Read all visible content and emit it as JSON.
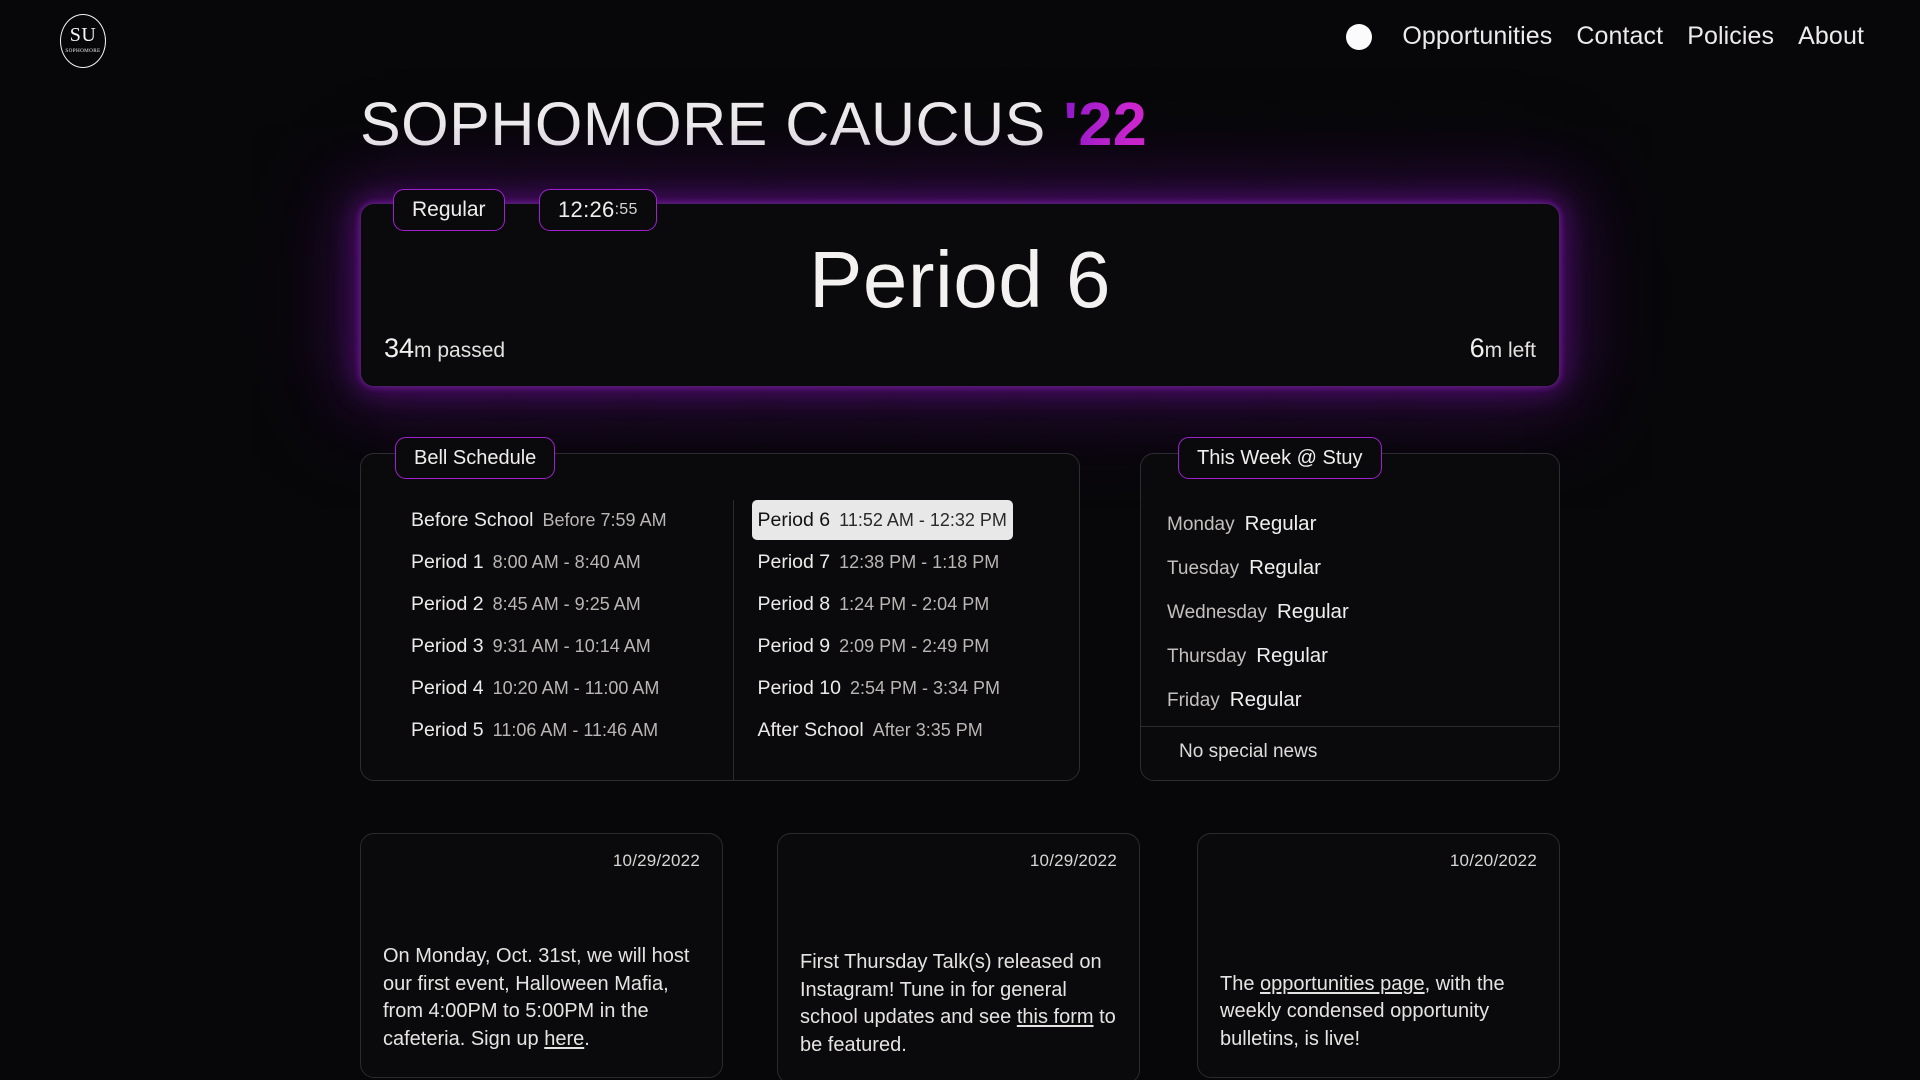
{
  "nav": {
    "logo": {
      "initials": "SU",
      "subtitle": "SOPHOMORE",
      "icon": "su-oval-logo-icon"
    },
    "indicator_icon": "status-dot-icon",
    "links": [
      {
        "label": "Opportunities"
      },
      {
        "label": "Contact"
      },
      {
        "label": "Policies"
      },
      {
        "label": "About"
      }
    ]
  },
  "header": {
    "title_main": "SOPHOMORE CAUCUS ",
    "title_year": "'22"
  },
  "period_card": {
    "schedule_type_pill": "Regular",
    "clock_hm": "12:26",
    "clock_seconds": ":55",
    "period_name": "Period 6",
    "elapsed_value": "34",
    "elapsed_label": "m passed",
    "remaining_value": "6",
    "remaining_label": "m left",
    "glow_color": "#8f1ec4",
    "border_color": "#4a1f68"
  },
  "bell_schedule": {
    "tab_label": "Bell Schedule",
    "left_column": [
      {
        "name": "Before School",
        "time": "Before 7:59 AM",
        "active": false
      },
      {
        "name": "Period 1",
        "time": "8:00 AM - 8:40 AM",
        "active": false
      },
      {
        "name": "Period 2",
        "time": "8:45 AM - 9:25 AM",
        "active": false
      },
      {
        "name": "Period 3",
        "time": "9:31 AM - 10:14 AM",
        "active": false
      },
      {
        "name": "Period 4",
        "time": "10:20 AM - 11:00 AM",
        "active": false
      },
      {
        "name": "Period 5",
        "time": "11:06 AM - 11:46 AM",
        "active": false
      }
    ],
    "right_column": [
      {
        "name": "Period 6",
        "time": "11:52 AM - 12:32 PM",
        "active": true
      },
      {
        "name": "Period 7",
        "time": "12:38 PM - 1:18 PM",
        "active": false
      },
      {
        "name": "Period 8",
        "time": "1:24 PM - 2:04 PM",
        "active": false
      },
      {
        "name": "Period 9",
        "time": "2:09 PM - 2:49 PM",
        "active": false
      },
      {
        "name": "Period 10",
        "time": "2:54 PM - 3:34 PM",
        "active": false
      },
      {
        "name": "After School",
        "time": "After 3:35 PM",
        "active": false
      }
    ]
  },
  "this_week": {
    "tab_label": "This Week @ Stuy",
    "days": [
      {
        "day": "Monday",
        "schedule": "Regular"
      },
      {
        "day": "Tuesday",
        "schedule": "Regular"
      },
      {
        "day": "Wednesday",
        "schedule": "Regular"
      },
      {
        "day": "Thursday",
        "schedule": "Regular"
      },
      {
        "day": "Friday",
        "schedule": "Regular"
      }
    ],
    "news_note": "No special news"
  },
  "news_cards": [
    {
      "date": "10/29/2022",
      "parts": [
        {
          "t": "On Monday, Oct. 31st, we will host our first event, Halloween Mafia, from 4:00PM to 5:00PM in the cafeteria. Sign up ",
          "link": false
        },
        {
          "t": "here",
          "link": true
        },
        {
          "t": ".",
          "link": false
        }
      ]
    },
    {
      "date": "10/29/2022",
      "parts": [
        {
          "t": "First Thursday Talk(s) released on Instagram! Tune in for general school updates and see ",
          "link": false
        },
        {
          "t": "this form",
          "link": true
        },
        {
          "t": " to be featured.",
          "link": false
        }
      ]
    },
    {
      "date": "10/20/2022",
      "parts": [
        {
          "t": "The ",
          "link": false
        },
        {
          "t": "opportunities page",
          "link": true
        },
        {
          "t": ", with the weekly condensed opportunity bulletins, is live!",
          "link": false
        }
      ]
    }
  ]
}
